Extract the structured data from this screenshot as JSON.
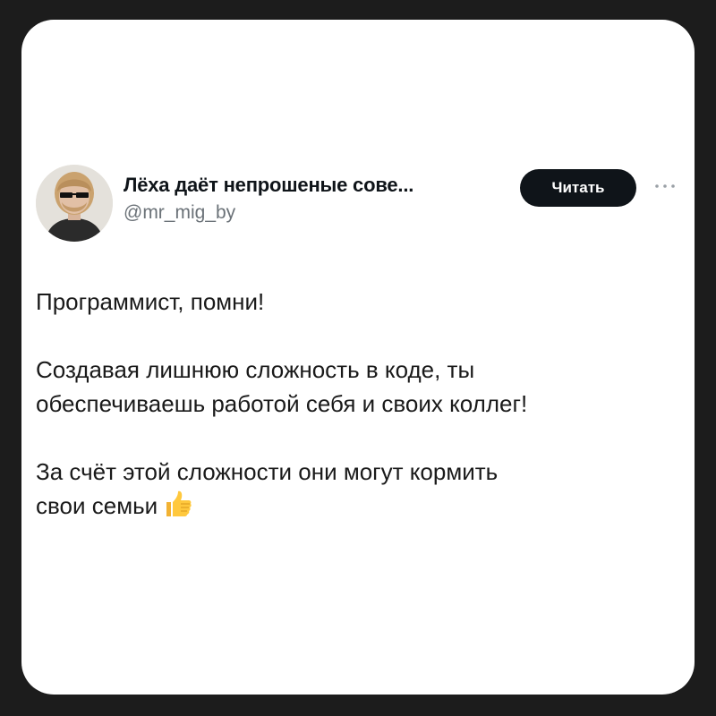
{
  "tweet": {
    "author": {
      "display_name": "Лёха даёт непрошеные сове...",
      "handle": "@mr_mig_by"
    },
    "follow_label": "Читать",
    "more_icon": "more-dots-icon",
    "lines": {
      "l1": "Программист, помни!",
      "l2": "Создавая лишнюю сложность в коде, ты",
      "l3": "обеспечиваешь работой себя и своих коллег!",
      "l4": "За счёт этой сложности они могут кормить",
      "l5": "свои семьи"
    },
    "emoji": "thumbs-up-icon"
  },
  "colors": {
    "background": "#1c1c1c",
    "card": "#ffffff",
    "button": "#0f1419",
    "handle": "#6b7278"
  }
}
